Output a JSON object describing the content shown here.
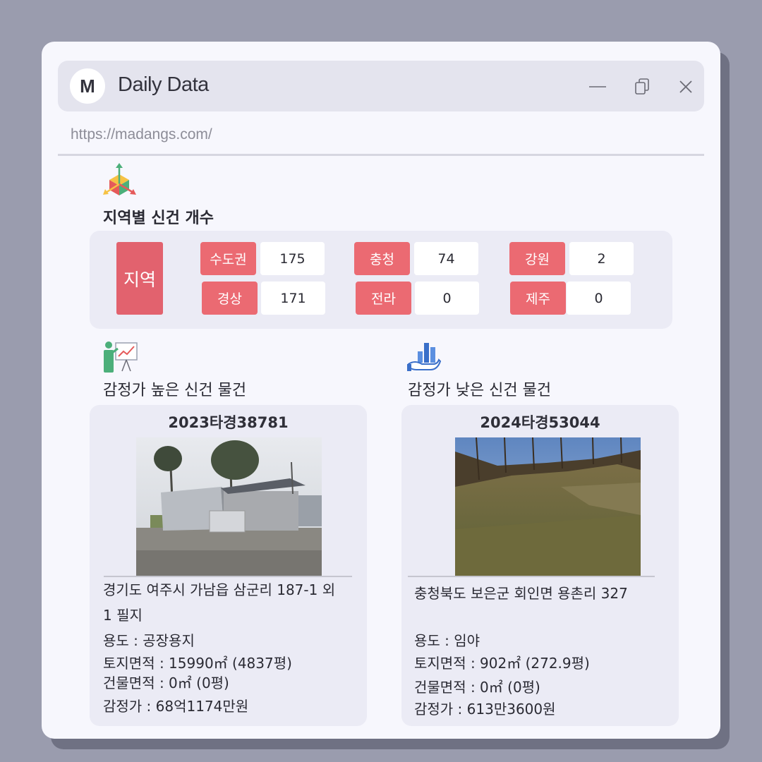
{
  "window": {
    "avatar_letter": "M",
    "title": "Daily Data",
    "url": "https://madangs.com/"
  },
  "icons": {
    "minimize": "minimize-icon",
    "restore": "restore-icon",
    "close": "close-icon",
    "region": "3d-axis-icon",
    "high": "presentation-chart-icon",
    "low": "hand-bar-chart-icon"
  },
  "region_section": {
    "title": "지역별 신건 개수",
    "label": "지역",
    "regions": [
      {
        "name": "수도권",
        "count": "175"
      },
      {
        "name": "충청",
        "count": "74"
      },
      {
        "name": "강원",
        "count": "2"
      },
      {
        "name": "경상",
        "count": "171"
      },
      {
        "name": "전라",
        "count": "0"
      },
      {
        "name": "제주",
        "count": "0"
      }
    ]
  },
  "high_section": {
    "title": "감정가 높은 신건 물건",
    "case_id": "2023타경38781",
    "address_line1": "경기도 여주시 가남읍 삼군리 187-1 외",
    "address_line2": "1 필지",
    "usage": "용도 : 공장용지",
    "land_area": "토지면적 : 15990㎡ (4837평)",
    "building_area": "건물면적 : 0㎡ (0평)",
    "appraisal": "감정가 : 68억1174만원"
  },
  "low_section": {
    "title": "감정가 낮은 신건 물건",
    "case_id": "2024타경53044",
    "address_line1": "충청북도 보은군 회인면 용촌리 327",
    "usage": "용도 :  임야",
    "land_area": "토지면적 : 902㎡ (272.9평)",
    "building_area": "건물면적 : 0㎡ (0평)",
    "appraisal": "감정가 : 613만3600원"
  },
  "colors": {
    "accent_red": "#e2626e",
    "window_bg": "#f7f7fd",
    "panel_bg": "#ebebf5",
    "outer_bg": "#9a9cae"
  }
}
